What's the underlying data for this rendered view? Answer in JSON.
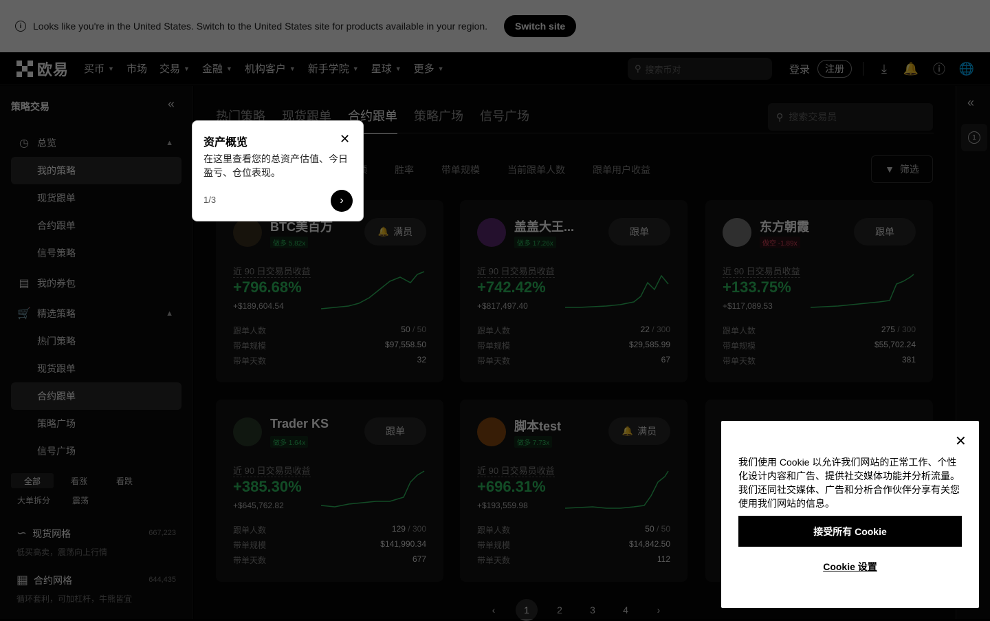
{
  "banner": {
    "message": "Looks like you're in the United States. Switch to the United States site for products available in your region.",
    "switch_label": "Switch site"
  },
  "nav": {
    "brand": "欧易",
    "items": [
      "买币",
      "市场",
      "交易",
      "金融",
      "机构客户",
      "新手学院",
      "星球",
      "更多"
    ],
    "search_placeholder": "搜索币对",
    "login": "登录",
    "register": "注册"
  },
  "sidebar": {
    "title": "策略交易",
    "overview": "总览",
    "my_strategy": "我的策略",
    "spot_copy": "现货跟单",
    "contract_copy": "合约跟单",
    "signal_strategy": "信号策略",
    "my_coupons": "我的券包",
    "featured": "精选策略",
    "hot_strategy": "热门策略",
    "spot_copy2": "现货跟单",
    "contract_copy2": "合约跟单",
    "strategy_square": "策略广场",
    "signal_square": "信号广场",
    "filters": [
      "全部",
      "看涨",
      "看跌",
      "大单拆分",
      "震荡"
    ],
    "spot_grid": {
      "title": "现货网格",
      "sub": "低买高卖，震荡向上行情",
      "count": "667,223"
    },
    "contract_grid": {
      "title": "合约网格",
      "sub": "循环套利，可加杠杆，牛熊皆宜",
      "count": "644,435"
    }
  },
  "main": {
    "tabs": [
      "热门策略",
      "现货跟单",
      "合约跟单",
      "策略广场",
      "信号广场"
    ],
    "active_tab": 2,
    "trader_search_placeholder": "搜索交易员",
    "sort_options": [
      "额",
      "胜率",
      "带单规模",
      "当前跟单人数",
      "跟单用户收益"
    ],
    "filter_label": "筛选",
    "profit_label": "近 90 日交易员收益",
    "stat_labels": [
      "跟单人数",
      "带单规模",
      "带单天数"
    ],
    "cards": [
      {
        "name": "BTC美百万",
        "tag": "做多 5.82x",
        "dir": "long",
        "action": "满员",
        "full": true,
        "pct": "+796.68%",
        "amount": "+$189,604.54",
        "followers": "50",
        "cap": "50",
        "scale": "$97,558.50",
        "days": "32"
      },
      {
        "name": "盖盖大王...",
        "tag": "做多 17.26x",
        "dir": "long",
        "action": "跟单",
        "full": false,
        "pct": "+742.42%",
        "amount": "+$817,497.40",
        "followers": "22",
        "cap": "300",
        "scale": "$29,585.99",
        "days": "67"
      },
      {
        "name": "东方朝霞",
        "tag": "做空 -1.89x",
        "dir": "short",
        "action": "跟单",
        "full": false,
        "pct": "+133.75%",
        "amount": "+$117,089.53",
        "followers": "275",
        "cap": "300",
        "scale": "$55,702.24",
        "days": "381"
      },
      {
        "name": "Trader KS",
        "tag": "做多 1.64x",
        "dir": "long",
        "action": "跟单",
        "full": false,
        "pct": "+385.30%",
        "amount": "+$645,762.82",
        "followers": "129",
        "cap": "300",
        "scale": "$141,990.34",
        "days": "677"
      },
      {
        "name": "脚本test",
        "tag": "做多 7.73x",
        "dir": "long",
        "action": "满员",
        "full": true,
        "pct": "+696.31%",
        "amount": "+$193,559.98",
        "followers": "50",
        "cap": "50",
        "scale": "$14,842.50",
        "days": "112"
      }
    ],
    "pages": [
      "1",
      "2",
      "3",
      "4"
    ]
  },
  "tooltip": {
    "title": "资产概览",
    "body": "在这里查看您的总资产估值、今日盈亏、仓位表现。",
    "step": "1/3"
  },
  "cookie": {
    "text": "我们使用 Cookie 以允许我们网站的正常工作、个性化设计内容和广告、提供社交媒体功能并分析流量。我们还同社交媒体、广告和分析合作伙伴分享有关您使用我们网站的信息。",
    "accept": "接受所有 Cookie",
    "settings": "Cookie 设置"
  },
  "colors": {
    "profit_green": "#2fbd5f",
    "loss_red": "#e0475e",
    "accent": "#000000"
  }
}
